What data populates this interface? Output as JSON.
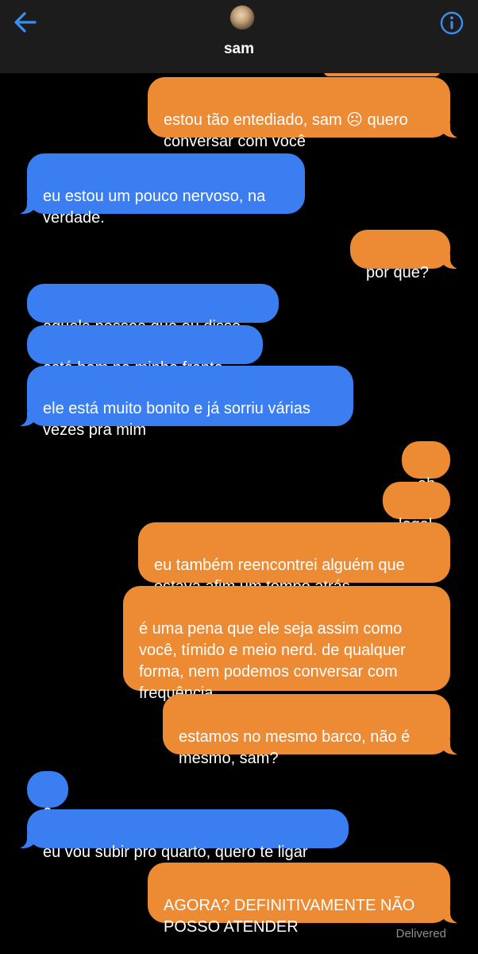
{
  "header": {
    "contact_name": "sam",
    "back_icon": "back-arrow-icon",
    "info_icon": "info-icon",
    "accent_color": "#3a8ff0"
  },
  "colors": {
    "outgoing_bubble": "#ec8b34",
    "incoming_bubble": "#3a7ef1",
    "background": "#000000"
  },
  "messages": [
    {
      "direction": "outgoing",
      "text": "estou tão entediado, sam ☹ quero conversar com você"
    },
    {
      "direction": "incoming",
      "text": "eu estou um pouco nervoso, na verdade."
    },
    {
      "direction": "outgoing",
      "text": "por que?"
    },
    {
      "direction": "incoming",
      "text": "aquela pessoa que eu disse."
    },
    {
      "direction": "incoming",
      "text": "está bem na minha frente"
    },
    {
      "direction": "incoming",
      "text": "ele está muito bonito e já sorriu várias vezes pra mim"
    },
    {
      "direction": "outgoing",
      "text": "ah"
    },
    {
      "direction": "outgoing",
      "text": "legal"
    },
    {
      "direction": "outgoing",
      "text": "eu também reencontrei alguém que estava afim um tempo atrás"
    },
    {
      "direction": "outgoing",
      "text": "é uma pena que ele seja assim como você, tímido e meio nerd. de qualquer forma, nem podemos conversar com frequência"
    },
    {
      "direction": "outgoing",
      "text": "estamos no mesmo barco, não é mesmo, sam?"
    },
    {
      "direction": "incoming",
      "text": "?"
    },
    {
      "direction": "incoming",
      "text": "eu vou subir pro quarto, quero te ligar"
    },
    {
      "direction": "outgoing",
      "text": "AGORA? DEFINITIVAMENTE NÃO POSSO ATENDER"
    }
  ],
  "delivery_status": "Delivered"
}
